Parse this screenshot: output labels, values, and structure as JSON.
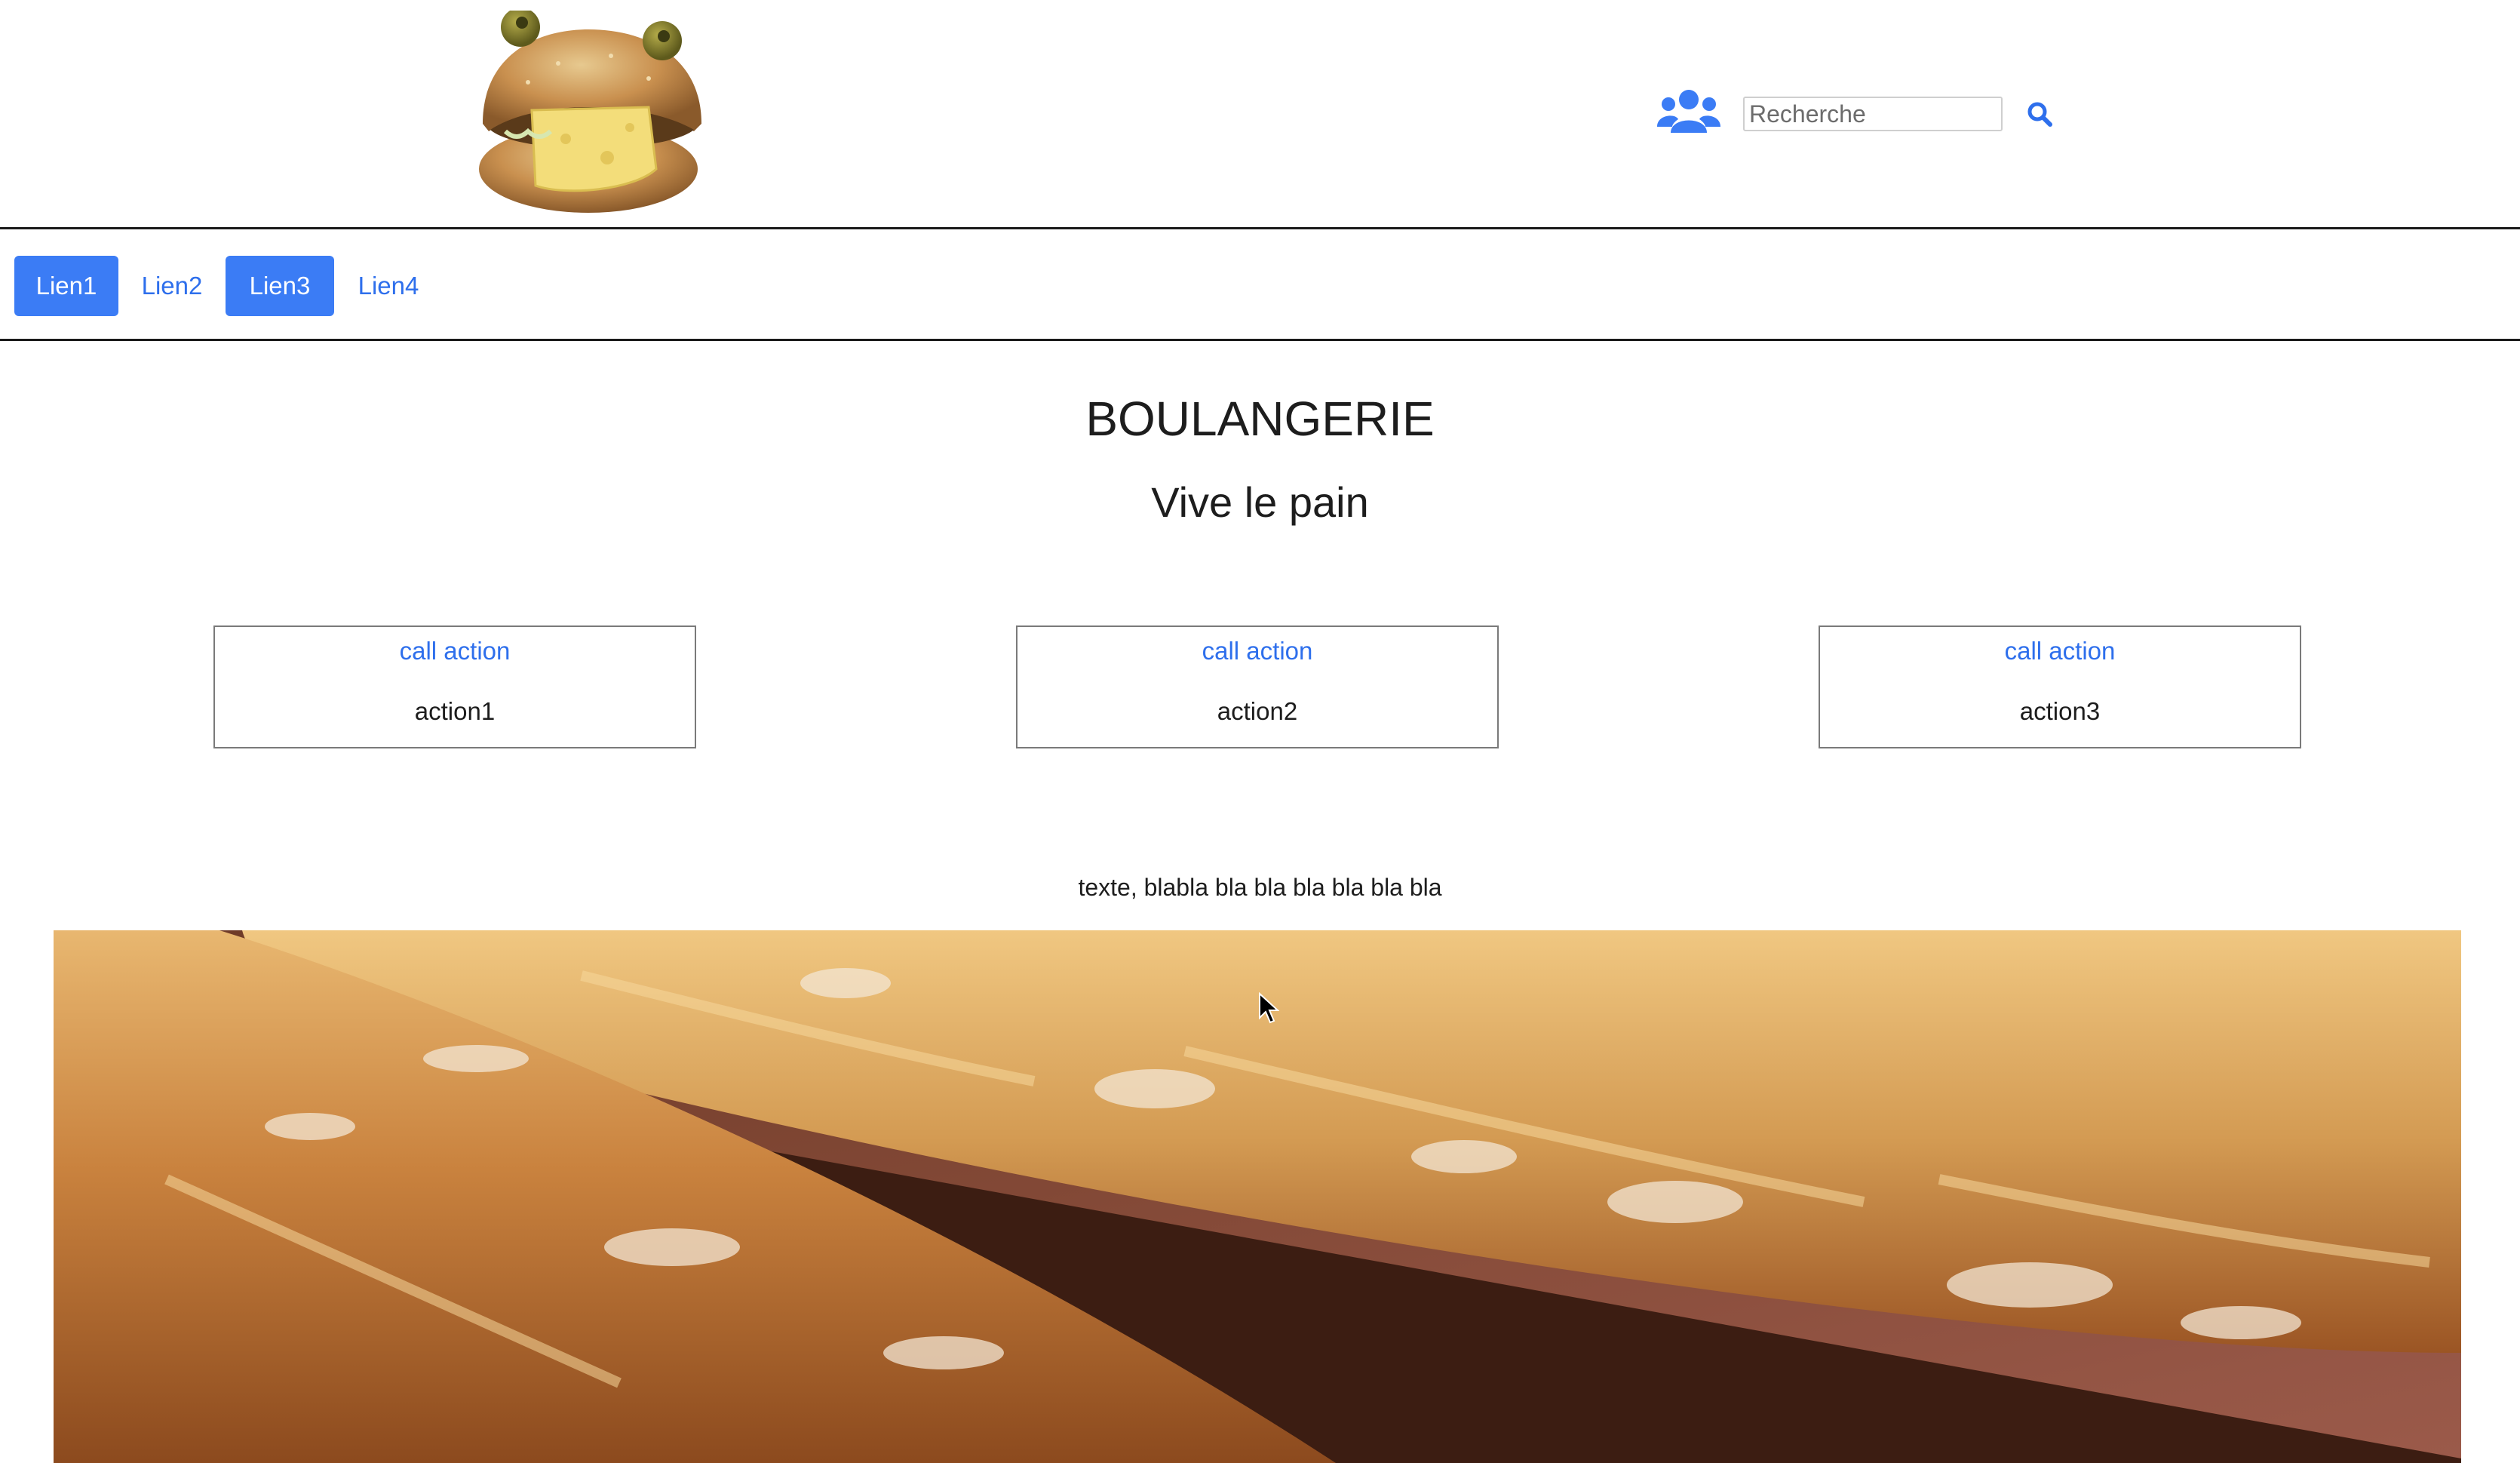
{
  "header": {
    "logo_name": "bread-frog-logo",
    "user_icon": "users-icon",
    "search": {
      "placeholder": "Recherche",
      "value": "",
      "icon": "search-icon"
    }
  },
  "nav": {
    "links": [
      {
        "label": "Lien1",
        "active": true
      },
      {
        "label": "Lien2",
        "active": false
      },
      {
        "label": "Lien3",
        "active": true
      },
      {
        "label": "Lien4",
        "active": false
      }
    ]
  },
  "main": {
    "title": "BOULANGERIE",
    "subtitle": "Vive le pain",
    "cards": [
      {
        "link": "call action",
        "text": "action1"
      },
      {
        "link": "call action",
        "text": "action2"
      },
      {
        "link": "call action",
        "text": "action3"
      }
    ],
    "body_text": "texte, blabla bla bla bla bla bla bla"
  },
  "colors": {
    "accent": "#3b7cf5",
    "link": "#2e6fec",
    "border": "#1a1a1a"
  }
}
